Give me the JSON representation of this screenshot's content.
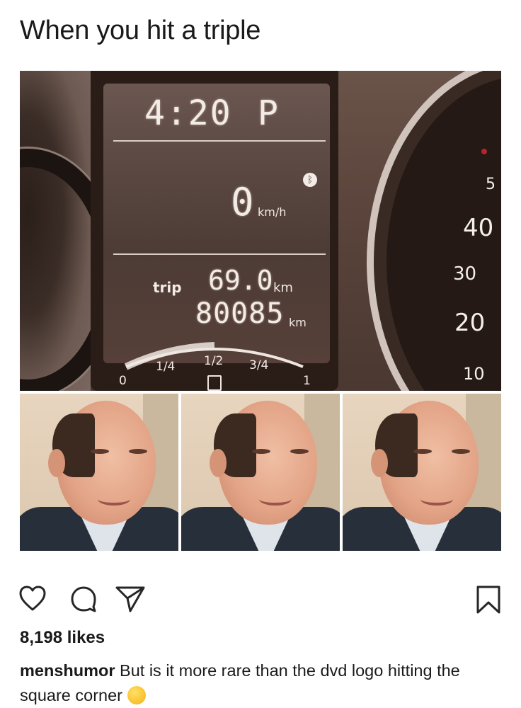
{
  "post": {
    "meme_text": "When you hit a triple",
    "dashboard": {
      "clock": "4:20",
      "clock_suffix": "P",
      "speed": "0",
      "speed_unit": "km/h",
      "trip_label": "trip",
      "trip_value": "69.0",
      "trip_unit": "km",
      "odometer": "80085",
      "odometer_unit": "km",
      "fuel_ticks": [
        "0",
        "1/4",
        "1/2",
        "3/4",
        "1"
      ],
      "gauge_numbers": [
        "5",
        "40",
        "30",
        "20",
        "10"
      ]
    },
    "photo_count": 3
  },
  "actions": {
    "like_icon": "heart-icon",
    "comment_icon": "comment-icon",
    "share_icon": "share-icon",
    "save_icon": "bookmark-icon"
  },
  "likes_text": "8,198 likes",
  "caption": {
    "username": "menshumor",
    "text": "But is it more rare than the dvd logo hitting the square corner",
    "emoji": "thinking-face-emoji"
  }
}
